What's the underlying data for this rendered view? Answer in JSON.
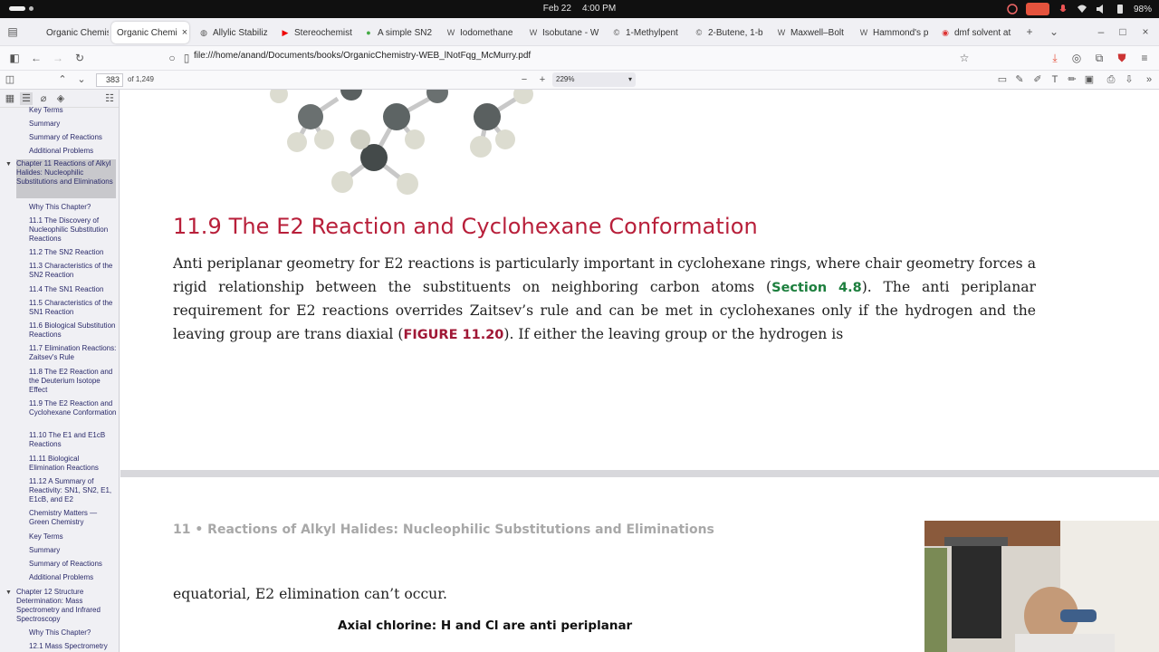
{
  "system": {
    "date": "Feb 22",
    "time": "4:00 PM",
    "battery": "98%"
  },
  "tabs": [
    {
      "label": "Organic Chemist",
      "icon": "pdf-icon"
    },
    {
      "label": "Organic Chemi",
      "icon": "pdf-icon",
      "active": true
    },
    {
      "label": "Allylic Stabiliz",
      "icon": "globe-icon"
    },
    {
      "label": "Stereochemist",
      "icon": "youtube-icon"
    },
    {
      "label": "A simple SN2",
      "icon": "leaf-icon"
    },
    {
      "label": "Iodomethane",
      "icon": "wikipedia-icon"
    },
    {
      "label": "Isobutane - W",
      "icon": "wikipedia-icon"
    },
    {
      "label": "1-Methylpent",
      "icon": "copyright-icon"
    },
    {
      "label": "2-Butene, 1-b",
      "icon": "copyright-icon"
    },
    {
      "label": "Maxwell–Bolt",
      "icon": "wikipedia-icon"
    },
    {
      "label": "Hammond's p",
      "icon": "wikipedia-icon"
    },
    {
      "label": "dmf solvent at",
      "icon": "circle-icon"
    }
  ],
  "nav": {
    "url": "file:///home/anand/Documents/books/OrganicChemistry-WEB_lNotFqg_McMurry.pdf"
  },
  "pdf": {
    "page": "383",
    "page_count": "of 1,249",
    "zoom": "229%"
  },
  "sidebar": {
    "items": [
      {
        "label": "Key Terms",
        "level": 2
      },
      {
        "label": "Summary",
        "level": 2
      },
      {
        "label": "Summary of Reactions",
        "level": 2
      },
      {
        "label": "Additional Problems",
        "level": 2
      },
      {
        "label": "Chapter 11 Reactions of Alkyl Halides: Nucleophilic Substitutions and Eliminations",
        "level": 1,
        "selected": true
      },
      {
        "label": "Why This Chapter?",
        "level": 2
      },
      {
        "label": "11.1 The Discovery of Nucleophilic Substitution Reactions",
        "level": 2
      },
      {
        "label": "11.2 The SN2 Reaction",
        "level": 2
      },
      {
        "label": "11.3 Characteristics of the SN2 Reaction",
        "level": 2
      },
      {
        "label": "11.4 The SN1 Reaction",
        "level": 2
      },
      {
        "label": "11.5 Characteristics of the SN1 Reaction",
        "level": 2
      },
      {
        "label": "11.6 Biological Substitution Reactions",
        "level": 2
      },
      {
        "label": "11.7 Elimination Reactions: Zaitsev's Rule",
        "level": 2
      },
      {
        "label": "11.8 The E2 Reaction and the Deuterium Isotope Effect",
        "level": 2
      },
      {
        "label": "11.9 The E2 Reaction and Cyclohexane Conformation",
        "level": 2
      },
      {
        "label": "11.10 The E1 and E1cB Reactions",
        "level": 2
      },
      {
        "label": "11.11 Biological Elimination Reactions",
        "level": 2
      },
      {
        "label": "11.12 A Summary of Reactivity: SN1, SN2, E1, E1cB, and E2",
        "level": 2
      },
      {
        "label": "Chemistry Matters — Green Chemistry",
        "level": 2
      },
      {
        "label": "Key Terms",
        "level": 2
      },
      {
        "label": "Summary",
        "level": 2
      },
      {
        "label": "Summary of Reactions",
        "level": 2
      },
      {
        "label": "Additional Problems",
        "level": 2
      },
      {
        "label": "Chapter 12 Structure Determination: Mass Spectrometry and Infrared Spectroscopy",
        "level": 1
      },
      {
        "label": "Why This Chapter?",
        "level": 2
      },
      {
        "label": "12.1 Mass Spectrometry",
        "level": 2
      }
    ]
  },
  "document": {
    "section_title": "11.9 The E2 Reaction and Cyclohexane Conformation",
    "para_part1": "Anti periplanar geometry for E2 reactions is particularly important in cyclohexane rings, where chair geometry forces a rigid relationship between the substituents on neighboring carbon atoms (",
    "link_section": "Section 4.8",
    "para_part2": "). The anti periplanar requirement for E2 reactions overrides Zaitsev’s rule and can be met in cyclohexanes only if the hydrogen and the leaving group are trans diaxial (",
    "link_figure": "FIGURE 11.20",
    "para_part3": "). If either the leaving group or the hydrogen is",
    "running_header": "11 • Reactions of Alkyl Halides: Nucleophilic Substitutions and Eliminations",
    "continuation": "equatorial, E2 elimination can’t occur.",
    "figure_caption": "Axial chlorine: H and Cl are anti periplanar"
  }
}
